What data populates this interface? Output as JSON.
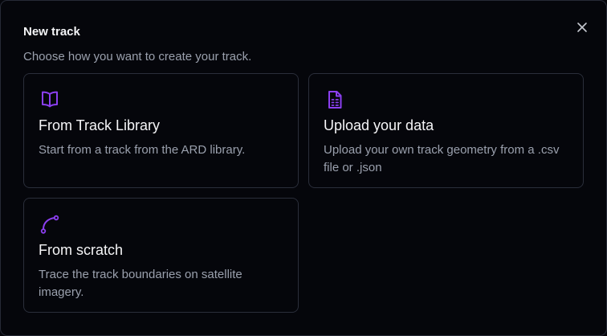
{
  "dialog": {
    "title": "New track",
    "subtitle": "Choose how you want to create your track.",
    "close_icon": "close-icon",
    "accent_color": "#8b3ff0"
  },
  "options": [
    {
      "icon": "book-open-icon",
      "title": "From Track Library",
      "description": "Start from a track from the ARD library."
    },
    {
      "icon": "file-spreadsheet-icon",
      "title": "Upload your data",
      "description": "Upload your own track geometry from a .csv file or .json"
    },
    {
      "icon": "curve-path-icon",
      "title": "From scratch",
      "description": "Trace the track boundaries on satellite imagery."
    }
  ]
}
